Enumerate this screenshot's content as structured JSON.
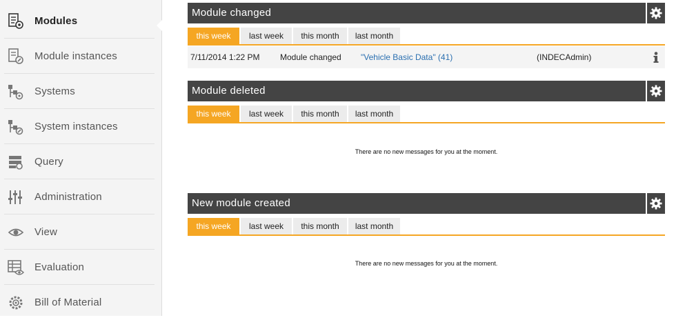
{
  "sidebar": {
    "items": [
      {
        "label": "Modules",
        "icon": "modules-icon"
      },
      {
        "label": "Module instances",
        "icon": "module-instances-icon"
      },
      {
        "label": "Systems",
        "icon": "systems-icon"
      },
      {
        "label": "System instances",
        "icon": "system-instances-icon"
      },
      {
        "label": "Query",
        "icon": "query-icon"
      },
      {
        "label": "Administration",
        "icon": "administration-icon"
      },
      {
        "label": "View",
        "icon": "eye-icon"
      },
      {
        "label": "Evaluation",
        "icon": "evaluation-icon"
      },
      {
        "label": "Bill of Material",
        "icon": "bill-of-material-icon"
      }
    ],
    "active": "Modules"
  },
  "tabs": [
    "this week",
    "last week",
    "this month",
    "last month"
  ],
  "panels": [
    {
      "title": "Module changed",
      "row": {
        "date": "7/11/2014 1:22 PM",
        "event": "Module changed",
        "link": "\"Vehicle Basic Data\" (41)",
        "user": "(INDECAdmin)"
      }
    },
    {
      "title": "Module deleted",
      "empty": "There are no new messages for you at the moment."
    },
    {
      "title": "New module created",
      "empty": "There are no new messages for you at the moment."
    }
  ],
  "colors": {
    "accent": "#f5a623",
    "header": "#444444",
    "link": "#2a6fb0"
  }
}
